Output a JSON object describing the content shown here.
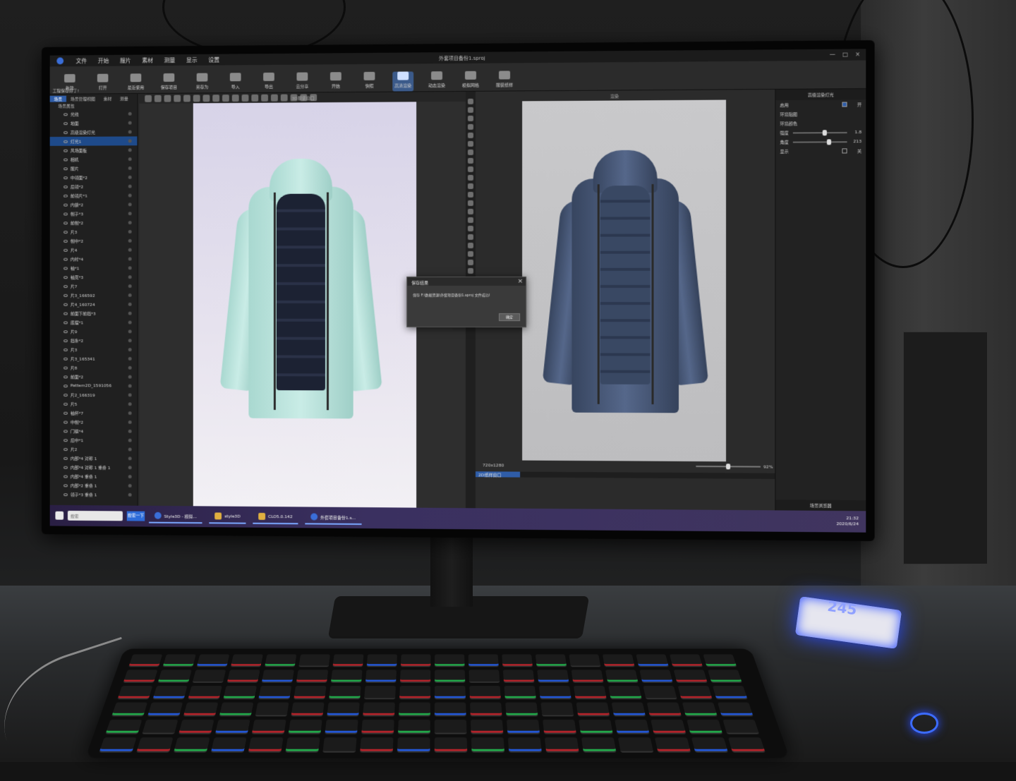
{
  "window": {
    "title": "外套项目备份1.sproj",
    "menu": [
      "文件",
      "开始",
      "服片",
      "素材",
      "测量",
      "显示",
      "设置"
    ],
    "controls": [
      "—",
      "□",
      "×"
    ]
  },
  "toolbar": {
    "hint": "工程保存好了!",
    "buttons": [
      {
        "label": "新建",
        "active": false
      },
      {
        "label": "打开",
        "active": false
      },
      {
        "label": "最近使用",
        "active": false
      },
      {
        "label": "保存项目",
        "active": false
      },
      {
        "label": "另存为",
        "active": false
      },
      {
        "label": "导入",
        "active": false
      },
      {
        "label": "导出",
        "active": false
      },
      {
        "label": "云分享",
        "active": false
      },
      {
        "label": "开始",
        "active": false
      },
      {
        "label": "快照",
        "active": false
      },
      {
        "label": "高清渲染",
        "active": true
      },
      {
        "label": "动态渲染",
        "active": false
      },
      {
        "label": "模拟网格",
        "active": false
      },
      {
        "label": "服装纸样",
        "active": false
      }
    ]
  },
  "left_panel": {
    "tabs": [
      "场景",
      "场景管理视图",
      "素材",
      "测量"
    ],
    "header": "场景属性",
    "tree": [
      {
        "label": "光线",
        "selected": false
      },
      {
        "label": "地面",
        "selected": false
      },
      {
        "label": "高级渲染灯光",
        "selected": false
      },
      {
        "label": "灯光1",
        "selected": true
      },
      {
        "label": "风场面板",
        "selected": false
      },
      {
        "label": "相机",
        "selected": false
      },
      {
        "label": "服片",
        "selected": false
      },
      {
        "label": "中领面*2",
        "selected": false
      },
      {
        "label": "后领*2",
        "selected": false
      },
      {
        "label": "前领片*1",
        "selected": false
      },
      {
        "label": "内袋*2",
        "selected": false
      },
      {
        "label": "帽子*3",
        "selected": false
      },
      {
        "label": "前帽*2",
        "selected": false
      },
      {
        "label": "片3",
        "selected": false
      },
      {
        "label": "帽中*2",
        "selected": false
      },
      {
        "label": "片4",
        "selected": false
      },
      {
        "label": "内衬*4",
        "selected": false
      },
      {
        "label": "袖*1",
        "selected": false
      },
      {
        "label": "袖克*3",
        "selected": false
      },
      {
        "label": "片7",
        "selected": false
      },
      {
        "label": "片3_166592",
        "selected": false
      },
      {
        "label": "片4_160724",
        "selected": false
      },
      {
        "label": "前面下前挡*3",
        "selected": false
      },
      {
        "label": "底摆*1",
        "selected": false
      },
      {
        "label": "片9",
        "selected": false
      },
      {
        "label": "挡条*2",
        "selected": false
      },
      {
        "label": "片3",
        "selected": false
      },
      {
        "label": "片3_165341",
        "selected": false
      },
      {
        "label": "片8",
        "selected": false
      },
      {
        "label": "前面*2",
        "selected": false
      },
      {
        "label": "Pattern2D_1591056",
        "selected": false
      },
      {
        "label": "片2_166319",
        "selected": false
      },
      {
        "label": "片5",
        "selected": false
      },
      {
        "label": "袖杯*7",
        "selected": false
      },
      {
        "label": "中帽*2",
        "selected": false
      },
      {
        "label": "门襟*4",
        "selected": false
      },
      {
        "label": "后中*1",
        "selected": false
      },
      {
        "label": "片2",
        "selected": false
      },
      {
        "label": "内部*4 对称 1",
        "selected": false
      },
      {
        "label": "内部*4 对称 1 重叠 1",
        "selected": false
      },
      {
        "label": "内部*4 重叠 1",
        "selected": false
      },
      {
        "label": "内部*2 重叠 1",
        "selected": false
      },
      {
        "label": "领子*3 重叠 1",
        "selected": false
      }
    ]
  },
  "viewport3d": {
    "title": "3D服装窗口"
  },
  "viewport_render": {
    "title": "渲染",
    "resolution": "720x1280",
    "zoom": "92%",
    "zoom_fraction": 0.5,
    "progress_label": "2D纸样窗口",
    "progress_fraction": 0.15
  },
  "properties": {
    "title": "高级渲染灯光",
    "rows": [
      {
        "label": "启用",
        "type": "check",
        "checked": true,
        "value": "开"
      },
      {
        "label": "环境贴图",
        "type": "text",
        "value": ""
      },
      {
        "label": "环境颜色",
        "type": "text",
        "value": ""
      },
      {
        "label": "强度",
        "type": "slider",
        "level": 0.6,
        "value": "1.8"
      },
      {
        "label": "角度",
        "type": "slider",
        "level": 0.7,
        "value": "213"
      },
      {
        "label": "显示",
        "type": "check",
        "checked": false,
        "value": "关"
      }
    ],
    "footer": "场景浏览器"
  },
  "dialog": {
    "title": "保存结果",
    "message": "保存 F:\\数据资源\\外套项目备份1.sproj 文件成功!",
    "ok_label": "确定"
  },
  "taskbar": {
    "search_placeholder": "搜索",
    "search_button": "搜索一下",
    "tasks": [
      {
        "label": "Style3D - 模拟...",
        "style": "blue"
      },
      {
        "label": "style3D",
        "style": "yellow"
      },
      {
        "label": "CLO5.0.142",
        "style": "yellow"
      },
      {
        "label": "外套项目备份1.s...",
        "style": "blue"
      }
    ],
    "time": "21:32",
    "date": "2020/6/24"
  },
  "desk": {
    "usb_hub_label": "245"
  },
  "colors": {
    "accent": "#2f5da8",
    "mint_jacket": "#bde6df",
    "navy_jacket": "#4a5a7a",
    "usb_glow": "#2a4cff"
  }
}
